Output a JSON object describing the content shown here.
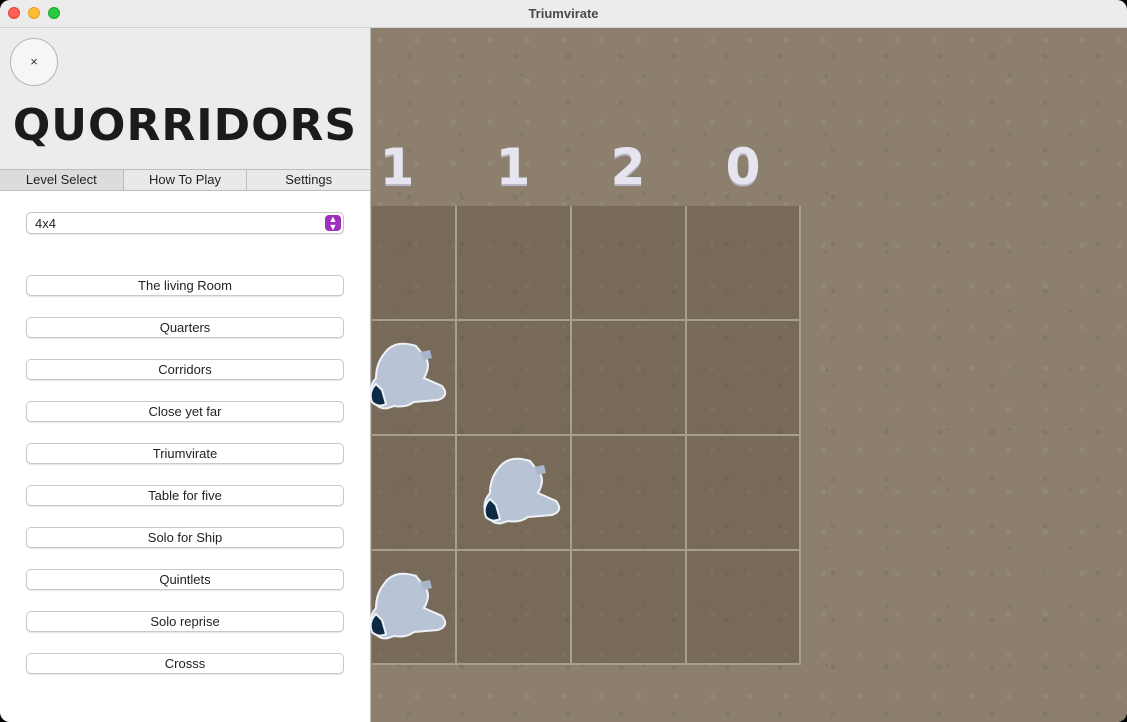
{
  "window": {
    "title": "Triumvirate"
  },
  "sidebar": {
    "close_label": "×",
    "logo": "QUORRIDORS",
    "tabs": [
      "Level Select",
      "How To Play",
      "Settings"
    ],
    "active_tab": "Level Select",
    "size_select": {
      "value": "4x4"
    },
    "levels": [
      "The living Room",
      "Quarters",
      "Corridors",
      "Close yet far",
      "Triumvirate",
      "Table for five",
      "Solo for Ship",
      "Quintlets",
      "Solo reprise",
      "Crosss"
    ]
  },
  "board": {
    "counters": [
      "1",
      "1",
      "2",
      "0"
    ],
    "grid_size": "4x4",
    "colors": {
      "sand": "#8c7f6d",
      "piece": "#b8c4d6",
      "piece_dark": "#0d2a44",
      "counter": "#e6e4ee",
      "select_accent": "#a12fbe"
    }
  }
}
